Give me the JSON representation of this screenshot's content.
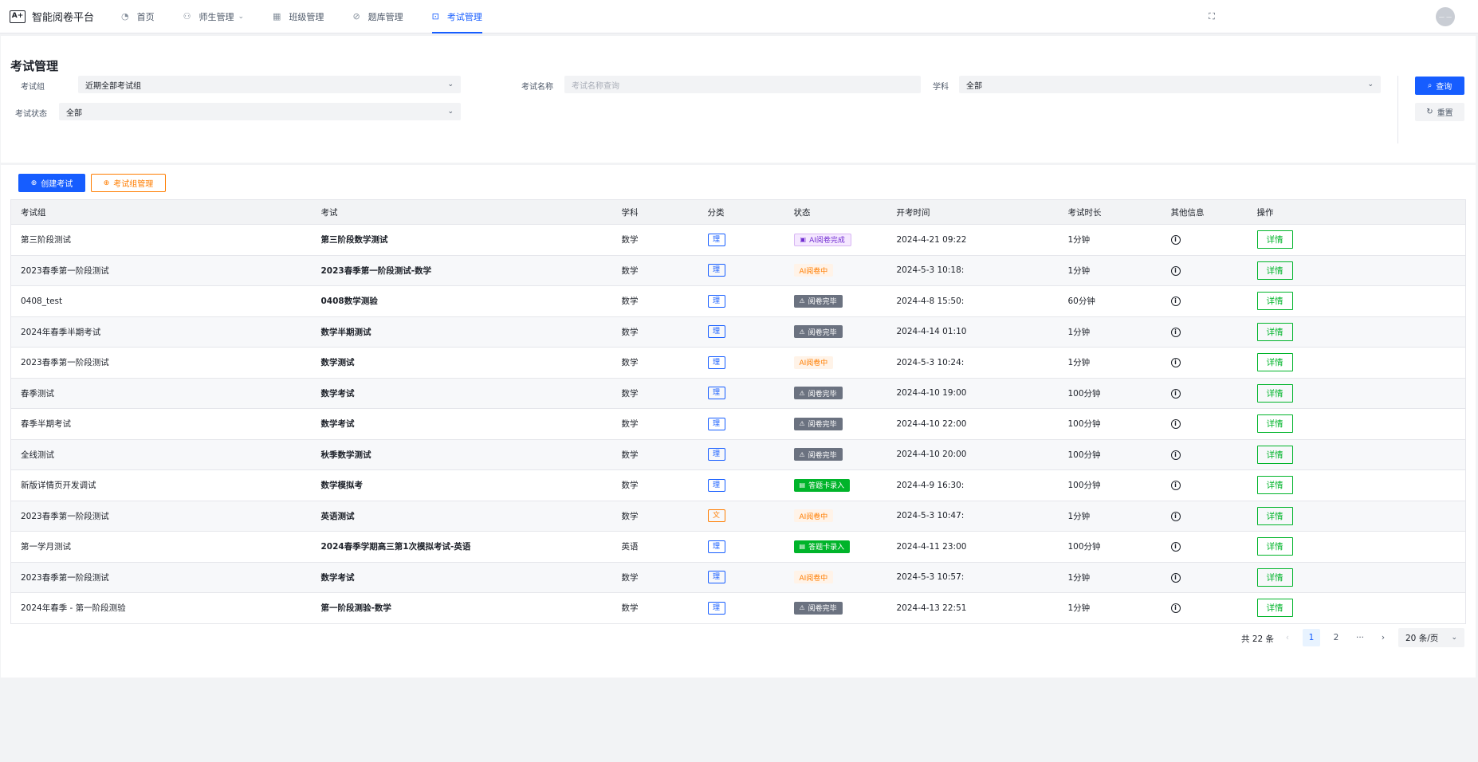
{
  "app": {
    "logo_mark": "A+",
    "title": "智能阅卷平台"
  },
  "nav": [
    {
      "label": "首页",
      "icon": "dashboard-icon",
      "glyph": "◔"
    },
    {
      "label": "师生管理",
      "icon": "users-icon",
      "glyph": "⚇"
    },
    {
      "label": "班级管理",
      "icon": "layout-icon",
      "glyph": "▦"
    },
    {
      "label": "题库管理",
      "icon": "attachment-icon",
      "glyph": "⊘"
    },
    {
      "label": "考试管理",
      "icon": "bookmark-icon",
      "glyph": "⊡"
    }
  ],
  "header": {
    "avatar_text": "— —"
  },
  "page": {
    "title": "考试管理"
  },
  "filters": {
    "group_label": "考试组",
    "group_value": "近期全部考试组",
    "name_label": "考试名称",
    "name_placeholder": "考试名称查询",
    "subject_label": "学科",
    "subject_value": "全部",
    "status_label": "考试状态",
    "status_value": "全部",
    "query_label": "查询",
    "reset_label": "重置"
  },
  "toolbar": {
    "create_label": "创建考试",
    "group_manage_label": "考试组管理"
  },
  "table": {
    "columns": [
      "考试组",
      "考试",
      "学科",
      "分类",
      "状态",
      "开考时间",
      "考试时长",
      "其他信息",
      "操作"
    ],
    "detail_label": "详情",
    "rows": [
      {
        "group": "第三阶段测试",
        "exam": "第三阶段数学测试",
        "subject": "数学",
        "category": "理",
        "status": "AI阅卷完成",
        "status_type": "purple",
        "start": "2024-4-21 09:22",
        "duration": "1分钟"
      },
      {
        "group": "2023春季第一阶段测试",
        "exam": "2023春季第一阶段测试-数学",
        "subject": "数学",
        "category": "理",
        "status": "AI阅卷中",
        "status_type": "orange",
        "start": "2024-5-3 10:18:",
        "duration": "1分钟"
      },
      {
        "group": "0408_test",
        "exam": "0408数学测验",
        "subject": "数学",
        "category": "理",
        "status": "阅卷完毕",
        "status_type": "gray",
        "start": "2024-4-8 15:50:",
        "duration": "60分钟"
      },
      {
        "group": "2024年春季半期考试",
        "exam": "数学半期测试",
        "subject": "数学",
        "category": "理",
        "status": "阅卷完毕",
        "status_type": "gray",
        "start": "2024-4-14 01:10",
        "duration": "1分钟"
      },
      {
        "group": "2023春季第一阶段测试",
        "exam": "数学测试",
        "subject": "数学",
        "category": "理",
        "status": "AI阅卷中",
        "status_type": "orange",
        "start": "2024-5-3 10:24:",
        "duration": "1分钟"
      },
      {
        "group": "春季测试",
        "exam": "数学考试",
        "subject": "数学",
        "category": "理",
        "status": "阅卷完毕",
        "status_type": "gray",
        "start": "2024-4-10 19:00",
        "duration": "100分钟"
      },
      {
        "group": "春季半期考试",
        "exam": "数学考试",
        "subject": "数学",
        "category": "理",
        "status": "阅卷完毕",
        "status_type": "gray",
        "start": "2024-4-10 22:00",
        "duration": "100分钟"
      },
      {
        "group": "全线测试",
        "exam": "秋季数学测试",
        "subject": "数学",
        "category": "理",
        "status": "阅卷完毕",
        "status_type": "gray",
        "start": "2024-4-10 20:00",
        "duration": "100分钟"
      },
      {
        "group": "新版详情页开发调试",
        "exam": "数学模拟考",
        "subject": "数学",
        "category": "理",
        "status": "答题卡录入",
        "status_type": "green",
        "start": "2024-4-9 16:30:",
        "duration": "100分钟"
      },
      {
        "group": "2023春季第一阶段测试",
        "exam": "英语测试",
        "subject": "数学",
        "category": "文",
        "status": "AI阅卷中",
        "status_type": "orange",
        "start": "2024-5-3 10:47:",
        "duration": "1分钟"
      },
      {
        "group": "第一学月测试",
        "exam": "2024春季学期高三第1次模拟考试-英语",
        "subject": "英语",
        "category": "理",
        "status": "答题卡录入",
        "status_type": "green",
        "start": "2024-4-11 23:00",
        "duration": "100分钟"
      },
      {
        "group": "2023春季第一阶段测试",
        "exam": "数学考试",
        "subject": "数学",
        "category": "理",
        "status": "AI阅卷中",
        "status_type": "orange",
        "start": "2024-5-3 10:57:",
        "duration": "1分钟"
      },
      {
        "group": "2024年春季 - 第一阶段测验",
        "exam": "第一阶段测验-数学",
        "subject": "数学",
        "category": "理",
        "status": "阅卷完毕",
        "status_type": "gray",
        "start": "2024-4-13 22:51",
        "duration": "1分钟"
      }
    ]
  },
  "pagination": {
    "total": "共 22 条",
    "prev": "‹",
    "pages": [
      "1",
      "2"
    ],
    "ellipsis": "···",
    "next": "›",
    "page_size": "20 条/页"
  }
}
